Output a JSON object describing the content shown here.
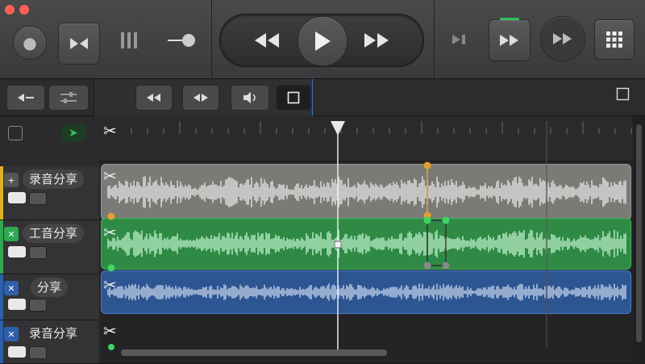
{
  "window": {
    "traffic_lights": [
      "#ff5f57",
      "#ff5f57"
    ]
  },
  "toolbar": {
    "buttons": [
      "library-icon",
      "smart-controls-icon",
      "mixer-icon",
      "editors-icon"
    ],
    "transport": [
      "rewind-icon",
      "play-icon",
      "fast-forward-icon"
    ],
    "right_buttons": [
      "go-to-end-icon",
      "cycle-icon",
      "tempo-icon",
      "grid-icon"
    ]
  },
  "subbar": {
    "left_buttons": [
      "catch-icon",
      "sliders-icon"
    ],
    "center_buttons": [
      "skip-back-icon",
      "split-arrows-icon",
      "volume-icon",
      "stop-square-icon"
    ],
    "right_icon": "fullscreen-square-icon"
  },
  "tracks": [
    {
      "name": "录音分享",
      "color": "#8a8a8a",
      "region_color": "#7c7a76",
      "wave_color": "#e8e8e8"
    },
    {
      "name": "工音分享",
      "color": "#2fa84f",
      "region_color": "#2e8a45",
      "wave_color": "#bff0cc"
    },
    {
      "name": "分享",
      "color": "#2e5fa8",
      "region_color": "#2c5592",
      "wave_color": "#c8d8ef"
    },
    {
      "name": "录音分享",
      "color": "#3a3a3c",
      "region_color": "#2a2a2c",
      "wave_color": "#555"
    }
  ],
  "playhead": {
    "label": "playhead"
  }
}
